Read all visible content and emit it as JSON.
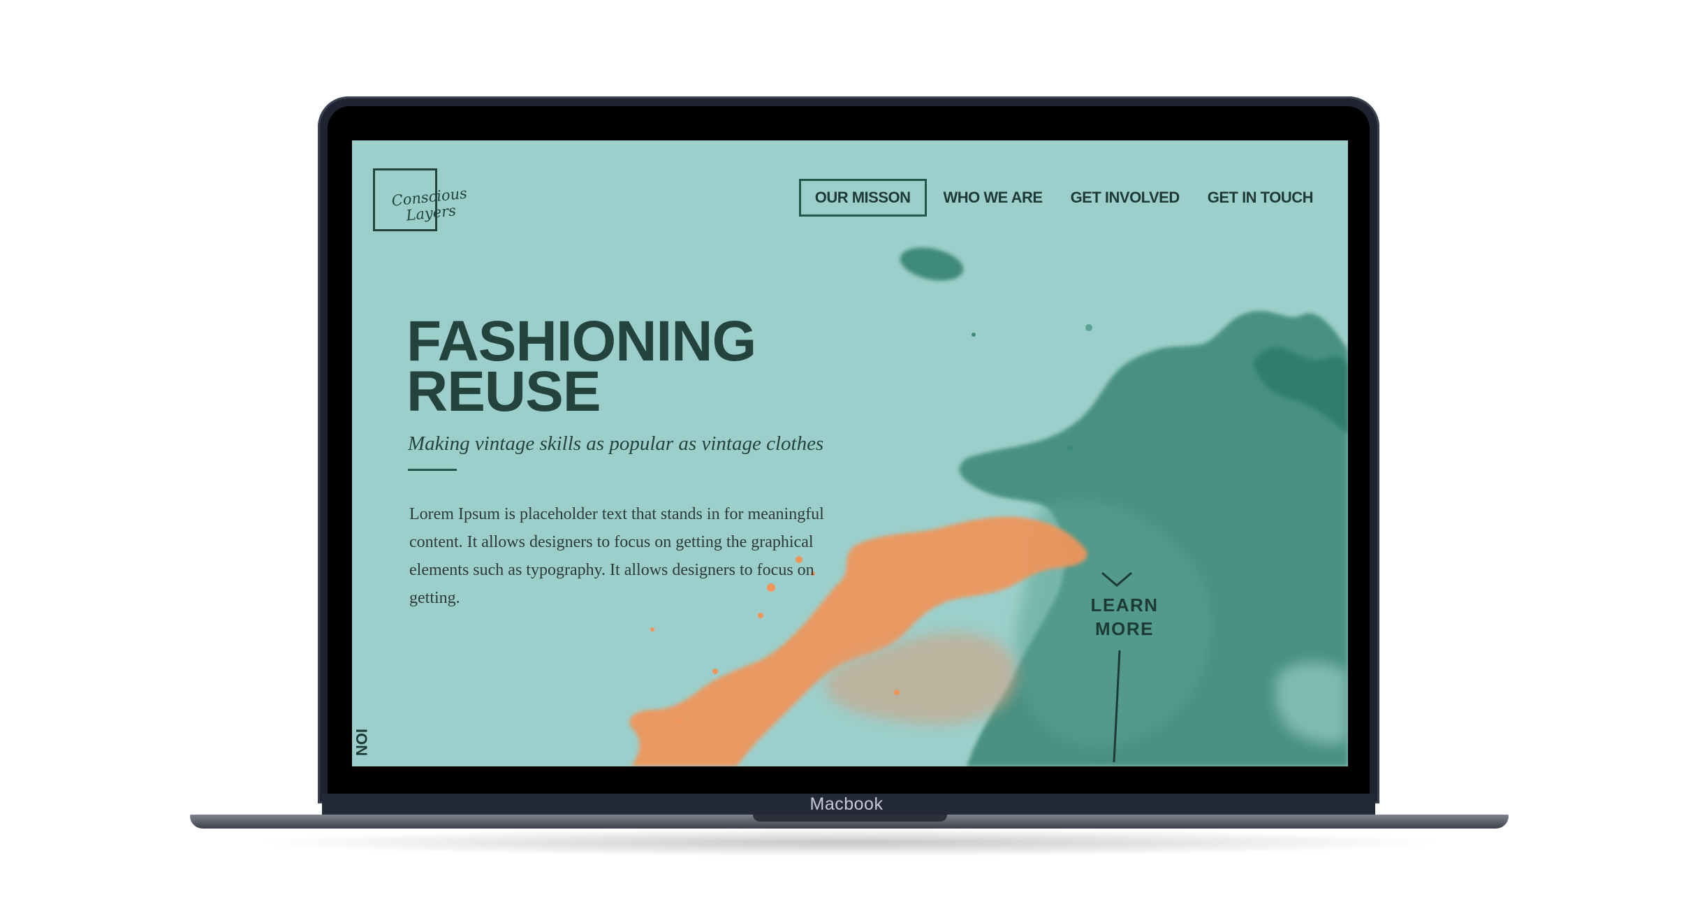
{
  "device": {
    "label": "Macbook"
  },
  "site": {
    "logo_text": "Conscious Layers",
    "nav": [
      {
        "label": "OUR MISSON",
        "active": true
      },
      {
        "label": "WHO WE ARE",
        "active": false
      },
      {
        "label": "GET INVOLVED",
        "active": false
      },
      {
        "label": "GET IN TOUCH",
        "active": false
      }
    ],
    "hero": {
      "title_line1": "FASHIONING",
      "title_line2": "REUSE",
      "tagline": "Making vintage skills as popular as vintage clothes",
      "body": "Lorem Ipsum is placeholder text that stands in for meaningful content. It allows designers to focus on getting the graphical elements such as typography. It allows designers to focus on getting."
    },
    "learn_more": {
      "line1": "LEARN",
      "line2": "MORE"
    },
    "side_label": "ION",
    "colors": {
      "background": "#9ccfcb",
      "ink": "#24433d",
      "teal_splash": "#3f8a7a",
      "orange_splash": "#f0955a"
    }
  }
}
